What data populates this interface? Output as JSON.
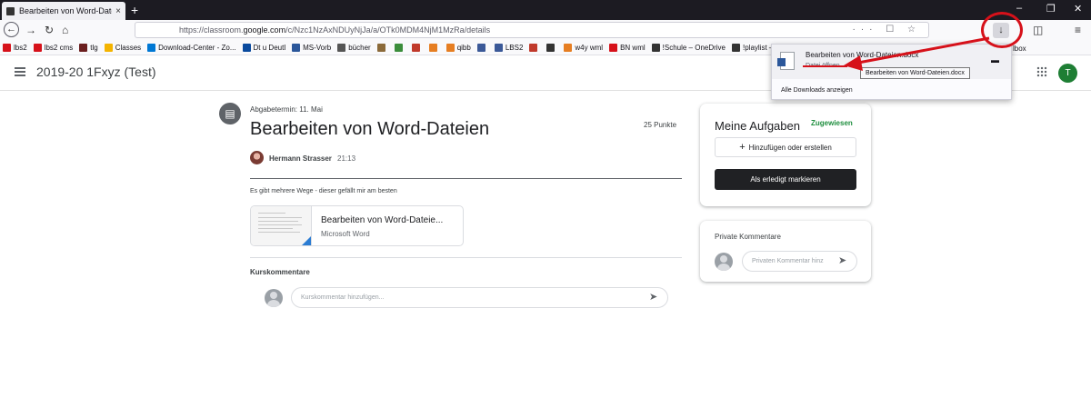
{
  "browser": {
    "tab_title": "Bearbeiten von Word-Dateien",
    "tab_close": "×",
    "newtab": "+",
    "window_min": "–",
    "window_max": "❐",
    "window_close": "✕",
    "url_prefix": "https://classroom.",
    "url_domain": "google.com",
    "url_path": "/c/Nzc1NzAxNDUyNjJa/a/OTk0MDM4NjM1MzRa/details",
    "url_icons": "··· ☐ ☆",
    "download_icon": "↓"
  },
  "bookmarks": [
    {
      "label": "lbs2",
      "color": "#d6111a"
    },
    {
      "label": "lbs2 cms",
      "color": "#d6111a"
    },
    {
      "label": "tlg",
      "color": "#6b1f1f"
    },
    {
      "label": "Classes",
      "color": "#f4b400"
    },
    {
      "label": "Download-Center - Zo...",
      "color": "#0078d4"
    },
    {
      "label": "Dt u Deutl",
      "color": "#0a4a9e"
    },
    {
      "label": "MS-Vorb",
      "color": "#2b579a"
    },
    {
      "label": "bücher",
      "color": "#555555"
    },
    {
      "label": "",
      "color": "#8b6a3a"
    },
    {
      "label": "",
      "color": "#3b8d3b"
    },
    {
      "label": "",
      "color": "#c0392b"
    },
    {
      "label": "",
      "color": "#e67e22"
    },
    {
      "label": "qibb",
      "color": "#e67e22"
    },
    {
      "label": "",
      "color": "#3b5998"
    },
    {
      "label": "LBS2",
      "color": "#3b5998"
    },
    {
      "label": "",
      "color": "#c0392b"
    },
    {
      "label": "",
      "color": "#333333"
    },
    {
      "label": "w4y wml",
      "color": "#e67e22"
    },
    {
      "label": "BN wml",
      "color": "#d6111a"
    },
    {
      "label": "!Schule – OneDrive",
      "color": "#333333"
    },
    {
      "label": "!playlist – On",
      "color": "#333333"
    }
  ],
  "app": {
    "class_title": "2019-20 1Fxyz (Test)",
    "user_initial": "T"
  },
  "assignment": {
    "icon": "▤",
    "due": "Abgabetermin: 11. Mai",
    "title": "Bearbeiten von Word-Dateien",
    "points": "25 Punkte",
    "author": "Hermann Strasser",
    "time": "21:13",
    "description": "Es gibt mehrere Wege - dieser gefällt mir am besten",
    "attachment_title": "Bearbeiten von Word-Dateie...",
    "attachment_type": "Microsoft Word"
  },
  "comments": {
    "class_label": "Kurskommentare",
    "class_placeholder": "Kurskommentar hinzufügen...",
    "send_icon": "➤",
    "private_label": "Private Kommentare",
    "private_placeholder": "Privaten Kommentar hinz"
  },
  "tasks": {
    "title": "Meine Aufgaben",
    "status": "Zugewiesen",
    "add_plus": "+",
    "add_label": "Hinzufügen oder erstellen",
    "done_label": "Als erledigt markieren"
  },
  "downloads": {
    "file_name": "Bearbeiten von Word-Dateien.docx",
    "open_label": "Datei öffnen",
    "folder_icon": "▬",
    "show_all": "Alle Downloads anzeigen",
    "tooltip": "Bearbeiten von Word-Dateien.docx",
    "overflow_text": "lbox"
  },
  "colors": {
    "annotation_red": "#d6111a",
    "status_green": "#1e8e3e",
    "avatar_green": "#1e7e34"
  }
}
